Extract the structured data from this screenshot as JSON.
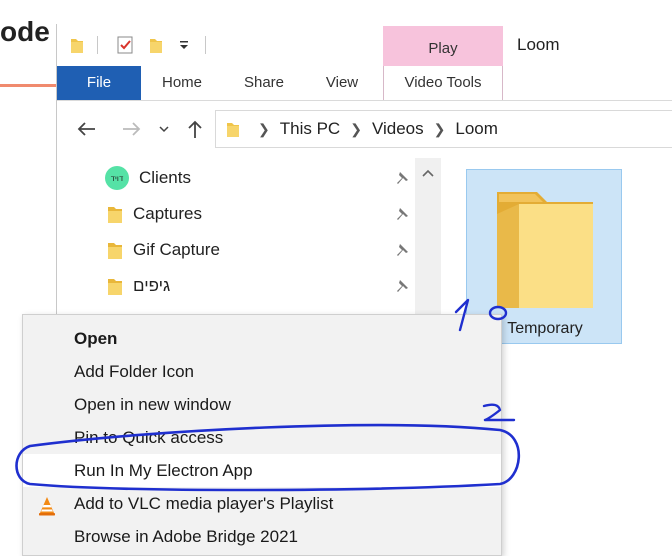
{
  "background_app": {
    "title_fragment": "ode"
  },
  "window": {
    "title": "Loom",
    "contextual_tab_group": "Play",
    "ribbon_tabs": [
      {
        "label": "File"
      },
      {
        "label": "Home"
      },
      {
        "label": "Share"
      },
      {
        "label": "View"
      },
      {
        "label": "Video Tools"
      }
    ]
  },
  "address_bar": {
    "crumbs": [
      "This PC",
      "Videos",
      "Loom"
    ]
  },
  "nav_pane": {
    "items": [
      {
        "label": "Clients",
        "icon": "app-circle-icon",
        "pinned": true
      },
      {
        "label": "Captures",
        "icon": "folder-icon",
        "pinned": true
      },
      {
        "label": "Gif Capture",
        "icon": "folder-icon",
        "pinned": true
      },
      {
        "label": "גיפים",
        "icon": "folder-icon",
        "pinned": true
      }
    ]
  },
  "content": {
    "selected_folder": {
      "label": "Temporary",
      "icon": "large-folder-icon"
    }
  },
  "context_menu": {
    "items": [
      {
        "label": "Open",
        "bold": true
      },
      {
        "label": "Add Folder Icon"
      },
      {
        "label": "Open in new window"
      },
      {
        "label": "Pin to Quick access"
      },
      {
        "label": "Run In My Electron App",
        "highlighted": true
      },
      {
        "label": "Add to VLC media player's Playlist",
        "icon": "vlc-cone-icon"
      },
      {
        "label": "Browse in Adobe Bridge 2021"
      }
    ]
  },
  "annotations": {
    "step1_label": "1",
    "step2_label": "2",
    "ink_color": "#1f2fcf"
  }
}
